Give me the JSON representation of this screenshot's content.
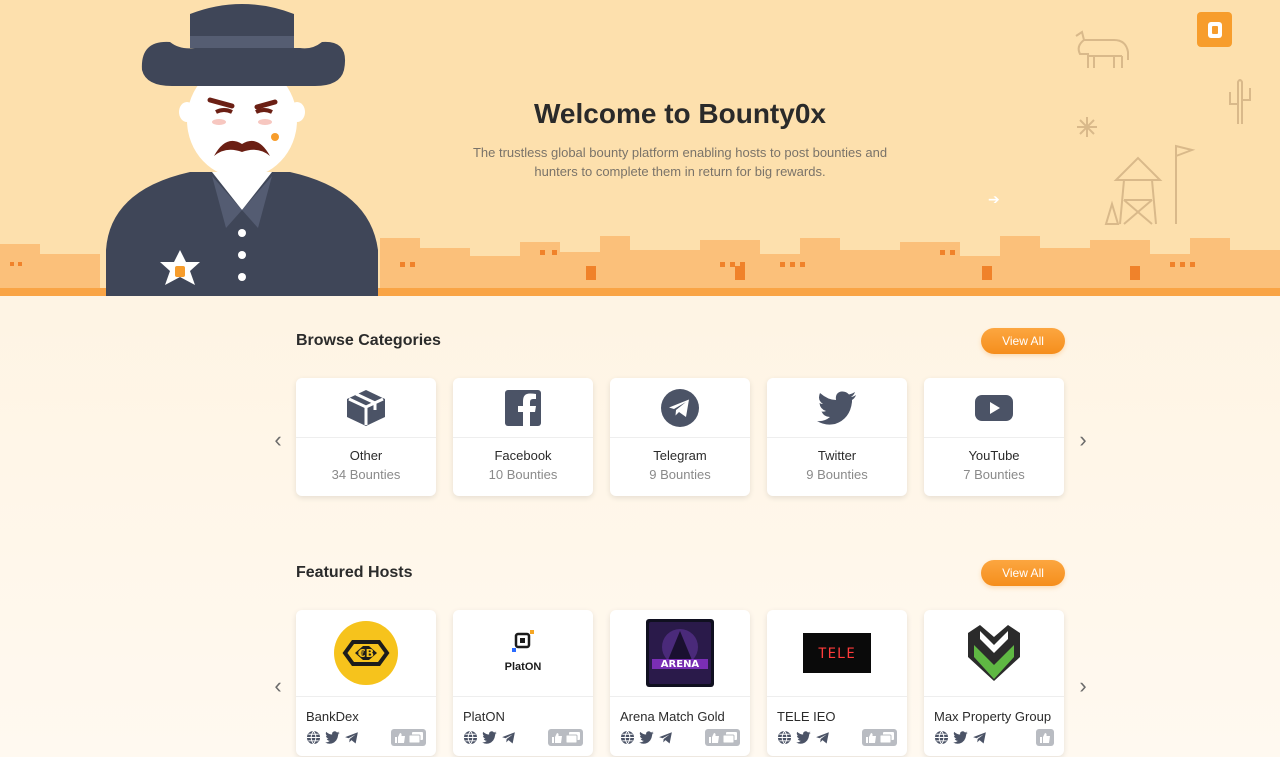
{
  "hero": {
    "title": "Welcome to Bounty0x",
    "subtitle_line1": "The trustless global bounty platform enabling hosts to post bounties and",
    "subtitle_line2": "hunters to complete them in return for big rewards.",
    "logo_letter": "B",
    "colors": {
      "background": "#fde0ad",
      "accent": "#f79d2c",
      "town": "#fbc07a"
    }
  },
  "categories": {
    "title": "Browse Categories",
    "view_all": "View All",
    "prev_arrow": "‹",
    "next_arrow": "›",
    "items": [
      {
        "name": "Other",
        "count": "34 Bounties",
        "icon": "cube-icon"
      },
      {
        "name": "Facebook",
        "count": "10 Bounties",
        "icon": "facebook-icon"
      },
      {
        "name": "Telegram",
        "count": "9 Bounties",
        "icon": "telegram-icon"
      },
      {
        "name": "Twitter",
        "count": "9 Bounties",
        "icon": "twitter-icon"
      },
      {
        "name": "YouTube",
        "count": "7 Bounties",
        "icon": "youtube-icon"
      }
    ]
  },
  "hosts": {
    "title": "Featured Hosts",
    "view_all": "View All",
    "prev_arrow": "‹",
    "next_arrow": "›",
    "items": [
      {
        "name": "BankDex",
        "logo": "bankdex-logo",
        "logo_text": "BankDex"
      },
      {
        "name": "PlatON",
        "logo": "platon-logo",
        "logo_text": "PlatON"
      },
      {
        "name": "Arena Match Gold",
        "logo": "arena-match-logo",
        "logo_text": "ARENA"
      },
      {
        "name": "TELE IEO",
        "logo": "tele-logo",
        "logo_text": "TELE"
      },
      {
        "name": "Max Property Group",
        "logo": "max-property-logo",
        "logo_text": ""
      }
    ]
  }
}
